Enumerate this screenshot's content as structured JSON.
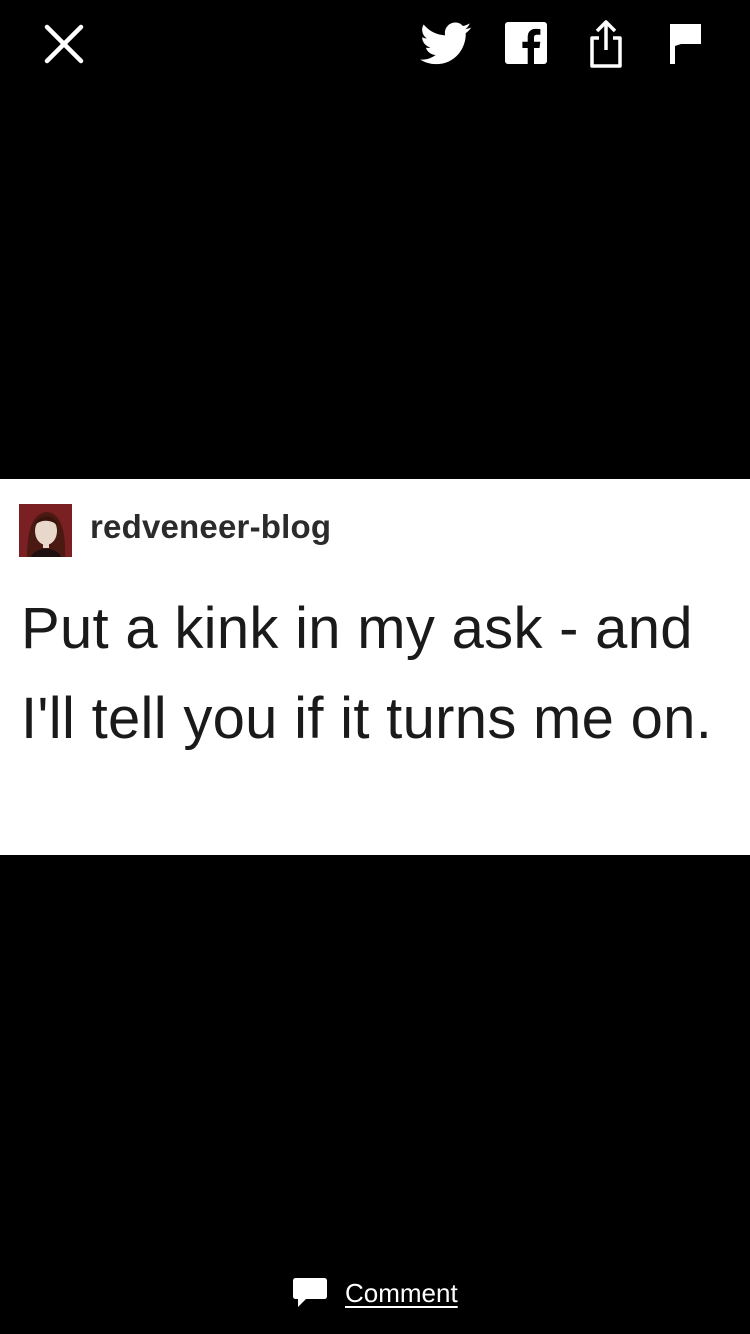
{
  "toolbar": {
    "icons": [
      "close-icon",
      "twitter-icon",
      "facebook-icon",
      "share-icon",
      "flag-icon"
    ]
  },
  "post": {
    "blog_name": "redveneer-blog",
    "text": "Put a kink in my ask - and I'll tell you if it turns me on."
  },
  "footer": {
    "comment_label": "Comment",
    "comment_icon": "speech-bubble-icon"
  },
  "colors": {
    "background": "#000000",
    "post_background": "#ffffff",
    "icon": "#ffffff",
    "text": "#1a1a1a"
  }
}
